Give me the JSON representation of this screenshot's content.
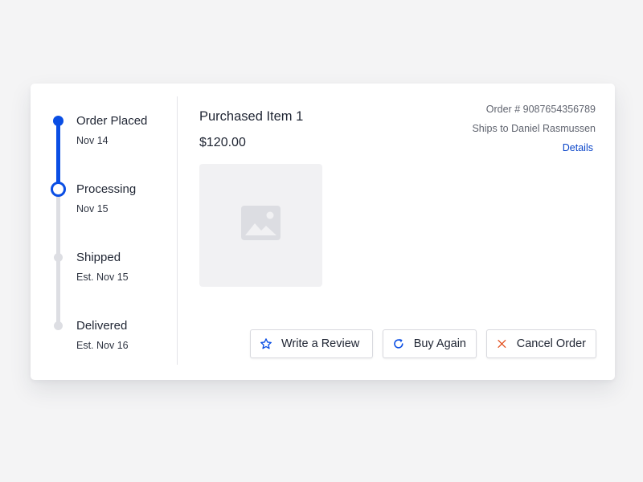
{
  "timeline": {
    "steps": [
      {
        "label": "Order Placed",
        "date": "Nov 14",
        "state": "done"
      },
      {
        "label": "Processing",
        "date": "Nov 15",
        "state": "current"
      },
      {
        "label": "Shipped",
        "date": "Est. Nov 15",
        "state": "pending"
      },
      {
        "label": "Delivered",
        "date": "Est. Nov 16",
        "state": "pending"
      }
    ]
  },
  "item": {
    "title": "Purchased Item 1",
    "price": "$120.00",
    "image_icon": "image-placeholder-icon"
  },
  "order": {
    "number": "Order # 9087654356789",
    "ships_to": "Ships to Daniel Rasmussen",
    "details_link": "Details"
  },
  "actions": {
    "write_review": {
      "label": "Write a Review",
      "icon": "star-outline-icon"
    },
    "buy_again": {
      "label": "Buy Again",
      "icon": "refresh-icon"
    },
    "cancel_order": {
      "label": "Cancel Order",
      "icon": "close-icon"
    }
  },
  "colors": {
    "accent": "#0a4ee4",
    "cancel": "#e2501f",
    "track_inactive": "#dddee3"
  }
}
